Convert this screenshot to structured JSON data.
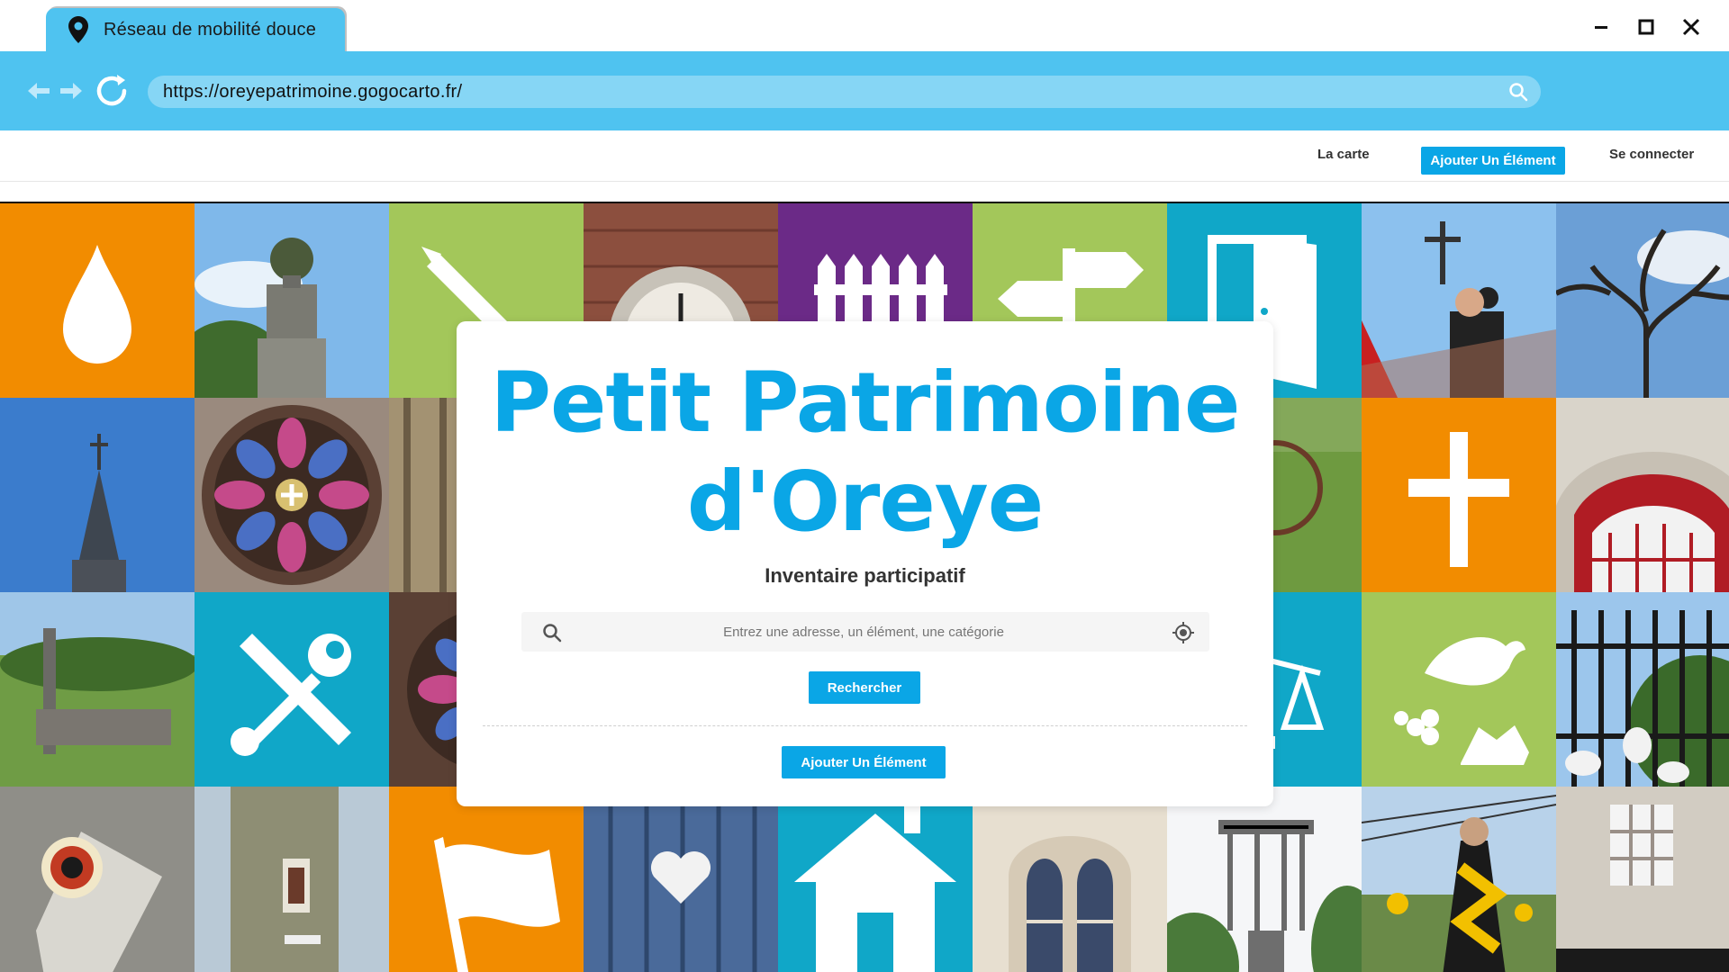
{
  "browser": {
    "tab_title": "Réseau de mobilité douce",
    "url": "https://oreyepatrimoine.gogocarto.fr/",
    "icons": [
      "map-pin-icon",
      "minimize-icon",
      "maximize-icon",
      "close-icon",
      "back-arrow-icon",
      "forward-arrow-icon",
      "reload-icon",
      "search-icon"
    ]
  },
  "header": {
    "menu": {
      "map_label": "La carte",
      "add_label": "Ajouter Un Élément",
      "login_label": "Se connecter"
    }
  },
  "hero": {
    "title_line1": "Petit Patrimoine",
    "title_line2": "d'Oreye",
    "subtitle": "Inventaire participatif",
    "search": {
      "placeholder": "Entrez une adresse, un élément, une catégorie",
      "value": "",
      "button_label": "Rechercher"
    },
    "add_button_label": "Ajouter Un Élément"
  },
  "colors": {
    "accent_blue": "#0aa6e6",
    "chrome_blue": "#4fc3f0",
    "tile_orange": "#f28c00",
    "tile_green": "#a3c75a",
    "tile_purple": "#6b2a87",
    "tile_teal": "#10a7c8"
  }
}
